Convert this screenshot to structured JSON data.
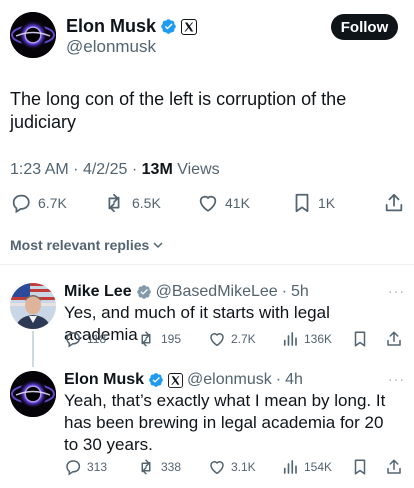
{
  "main_post": {
    "author_name": "Elon Musk",
    "handle": "@elonmusk",
    "follow_label": "Follow",
    "text": "The long con of the left is corruption of the judiciary",
    "time": "1:23 AM",
    "separator": "·",
    "date": "4/2/25",
    "views_count": "13M",
    "views_label": "Views",
    "stats": {
      "replies": "6.7K",
      "reposts": "6.5K",
      "likes": "41K",
      "bookmarks": "1K"
    }
  },
  "sort_label": "Most relevant replies",
  "replies": [
    {
      "author_name": "Mike Lee",
      "handle": "@BasedMikeLee",
      "separator": "·",
      "age": "5h",
      "more": "···",
      "text": "Yes, and much of it starts with legal academia",
      "stats": {
        "replies": "118",
        "reposts": "195",
        "likes": "2.7K",
        "views": "136K"
      }
    },
    {
      "author_name": "Elon Musk",
      "handle": "@elonmusk",
      "separator": "·",
      "age": "4h",
      "more": "···",
      "text": "Yeah, that’s exactly what I mean by long. It has been brewing in legal academia for 20 to 30 years.",
      "stats": {
        "replies": "313",
        "reposts": "338",
        "likes": "3.1K",
        "views": "154K"
      }
    }
  ],
  "colors": {
    "text_primary": "#0f1419",
    "text_secondary": "#536471",
    "verified_blue": "#1d9bf0",
    "divider": "#eff3f4"
  }
}
